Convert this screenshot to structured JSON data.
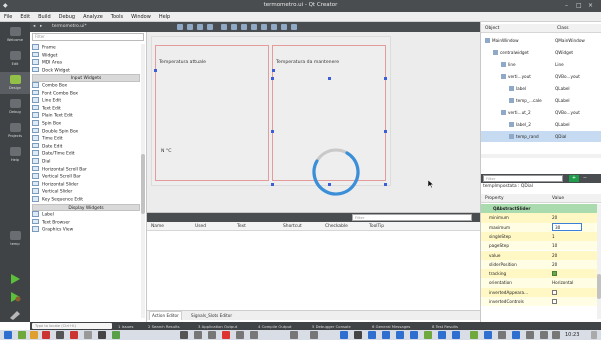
{
  "window": {
    "title": "termometro.ui - Qt Creator"
  },
  "menu": [
    "File",
    "Edit",
    "Build",
    "Debug",
    "Analyze",
    "Tools",
    "Window",
    "Help"
  ],
  "modes": [
    {
      "label": "Welcome"
    },
    {
      "label": "Edit"
    },
    {
      "label": "Design"
    },
    {
      "label": "Debug"
    },
    {
      "label": "Projects"
    },
    {
      "label": "Help"
    }
  ],
  "kit": {
    "label": "temp"
  },
  "widget_box": {
    "tab_label": "termometro.ui*",
    "filter_placeholder": "Filter",
    "items_top": [
      "Frame",
      "Widget",
      "MDI Area",
      "Dock Widget"
    ],
    "category_input": "Input Widgets",
    "input_items": [
      "Combo Box",
      "Font Combo Box",
      "Line Edit",
      "Text Edit",
      "Plain Text Edit",
      "Spin Box",
      "Double Spin Box",
      "Time Edit",
      "Date Edit",
      "Date/Time Edit",
      "Dial",
      "Horizontal Scroll Bar",
      "Vertical Scroll Bar",
      "Horizontal Slider",
      "Vertical Slider",
      "Key Sequence Edit"
    ],
    "category_display": "Display Widgets",
    "display_items": [
      "Label",
      "Text Browser",
      "Graphics View"
    ]
  },
  "form": {
    "group_left_caption": "Temperatura attuale",
    "group_right_caption": "Temperatura da mantenere",
    "value_label": "N °C"
  },
  "action_editor": {
    "filter_placeholder": "Filter",
    "columns": [
      "Name",
      "Used",
      "Text",
      "Shortcut",
      "Checkable",
      "ToolTip"
    ],
    "tabs": [
      "Action Editor",
      "Signals_Slots Editor"
    ]
  },
  "object_inspector": {
    "columns": [
      "Object",
      "Class"
    ],
    "rows": [
      {
        "name": "MainWindow",
        "cls": "QMainWindow",
        "indent": 0
      },
      {
        "name": "centralwidget",
        "cls": "QWidget",
        "indent": 1
      },
      {
        "name": "line",
        "cls": "Line",
        "indent": 2
      },
      {
        "name": "verti...yout",
        "cls": "QVBo...yout",
        "indent": 2
      },
      {
        "name": "label",
        "cls": "QLabel",
        "indent": 3
      },
      {
        "name": "temp_...cale",
        "cls": "QLabel",
        "indent": 3
      },
      {
        "name": "verti...ut_2",
        "cls": "QVBo...yout",
        "indent": 2
      },
      {
        "name": "label_2",
        "cls": "QLabel",
        "indent": 3
      },
      {
        "name": "temp_rand",
        "cls": "QDial",
        "indent": 3
      }
    ],
    "selected_index": 8
  },
  "property_editor": {
    "filter_placeholder": "Filter",
    "plus": "+",
    "minus": "−",
    "object_name": "tempImpostata : QDial",
    "columns": [
      "Property",
      "Value"
    ],
    "class_row": "QAbstractSlider",
    "rows": [
      {
        "name": "minimum",
        "value": "20",
        "kind": "text"
      },
      {
        "name": "maximum",
        "value": "30",
        "kind": "edit"
      },
      {
        "name": "singleStep",
        "value": "1",
        "kind": "text"
      },
      {
        "name": "pageStep",
        "value": "10",
        "kind": "text"
      },
      {
        "name": "value",
        "value": "20",
        "kind": "text"
      },
      {
        "name": "sliderPosition",
        "value": "20",
        "kind": "text"
      },
      {
        "name": "tracking",
        "value": "",
        "kind": "check_on"
      },
      {
        "name": "orientation",
        "value": "Horizontal",
        "kind": "text"
      },
      {
        "name": "invertedAppeara...",
        "value": "",
        "kind": "check_off"
      },
      {
        "name": "invertedControls",
        "value": "",
        "kind": "check_off"
      }
    ]
  },
  "output_bar": {
    "locator_placeholder": "Type to locate (Ctrl+K)",
    "panes": [
      "1 Issues",
      "2 Search Results",
      "3 Application Output",
      "4 Compile Output",
      "5 Debugger Console",
      "6 General Messages",
      "8 Test Results"
    ]
  },
  "taskbar": {
    "clock": "10:23"
  },
  "colors": {
    "accent_green": "#93c047",
    "selection_blue": "#c6dbf1",
    "dial_blue": "#3b8fd8",
    "layout_red": "#e39b9b"
  }
}
